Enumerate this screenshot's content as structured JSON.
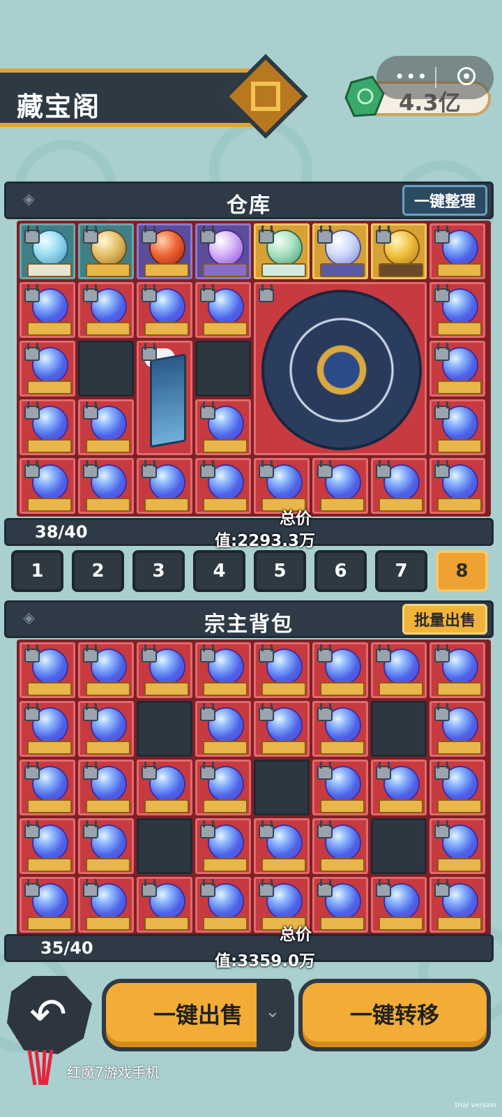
{
  "header": {
    "title": "藏宝阁",
    "currency_value": "4.3亿"
  },
  "capsule": {
    "dots": "•••"
  },
  "warehouse": {
    "title": "仓库",
    "button": "一键整理",
    "count": "38/40",
    "total_line1": "总价",
    "total_line2": "值:2293.3万"
  },
  "pages": [
    "1",
    "2",
    "3",
    "4",
    "5",
    "6",
    "7",
    "8"
  ],
  "active_page": "8",
  "backpack": {
    "title": "宗主背包",
    "button": "批量出售",
    "count": "35/40",
    "total_line1": "总价",
    "total_line2": "值:3359.0万"
  },
  "actions": {
    "sell_all": "一键出售",
    "transfer_all": "一键转移"
  },
  "brand": {
    "text": "红魔7游戏手机",
    "watermark": "trial version"
  },
  "colors": {
    "accent_gold": "#f1ad35",
    "panel_dark": "#2e3a46",
    "slot_red": "#c73a40"
  }
}
